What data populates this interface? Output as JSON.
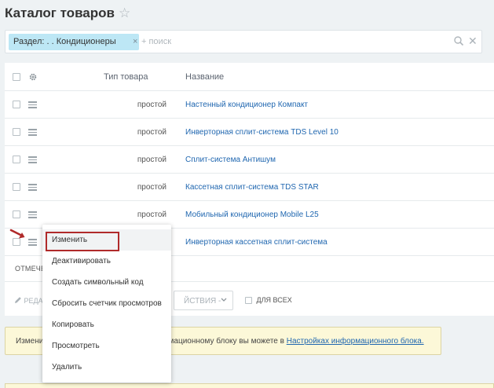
{
  "header": {
    "title": "Каталог товаров",
    "favorite_icon": "star-icon"
  },
  "filter": {
    "tag_label": "Раздел: . . Кондиционеры",
    "tag_close": "×",
    "add_label": "+ поиск",
    "clear_label": "✕"
  },
  "grid": {
    "columns": [
      "Тип товара",
      "Название"
    ],
    "rows": [
      {
        "type": "простой",
        "name": "Настенный кондиционер Компакт"
      },
      {
        "type": "простой",
        "name": "Инверторная сплит-система TDS Level 10"
      },
      {
        "type": "простой",
        "name": "Сплит-система Антишум"
      },
      {
        "type": "простой",
        "name": "Кассетная сплит-система TDS STAR"
      },
      {
        "type": "простой",
        "name": "Мобильный кондиционер Mobile L25"
      },
      {
        "type": "",
        "name": "Инверторная кассетная сплит-система"
      }
    ],
    "footer_label": "ОТМЕЧЕ",
    "edit_label": "РЕДА",
    "actions_label": "ЙСТВИЯ -",
    "for_all_label": "ДЛЯ ВСЕХ"
  },
  "context_menu": {
    "items": [
      "Изменить",
      "Деактивировать",
      "Создать символьный код",
      "Сбросить счетчик просмотров",
      "Копировать",
      "Просмотреть",
      "Удалить"
    ]
  },
  "notice": {
    "left_text": "Измени",
    "right_text": "рмационному блоку вы можете в",
    "link_text": "Настройках информационного блока."
  },
  "colors": {
    "link": "#2067b0",
    "tag_bg": "#bde7f5",
    "highlight": "#b02a2a",
    "notice_bg": "#fcf8d8"
  }
}
